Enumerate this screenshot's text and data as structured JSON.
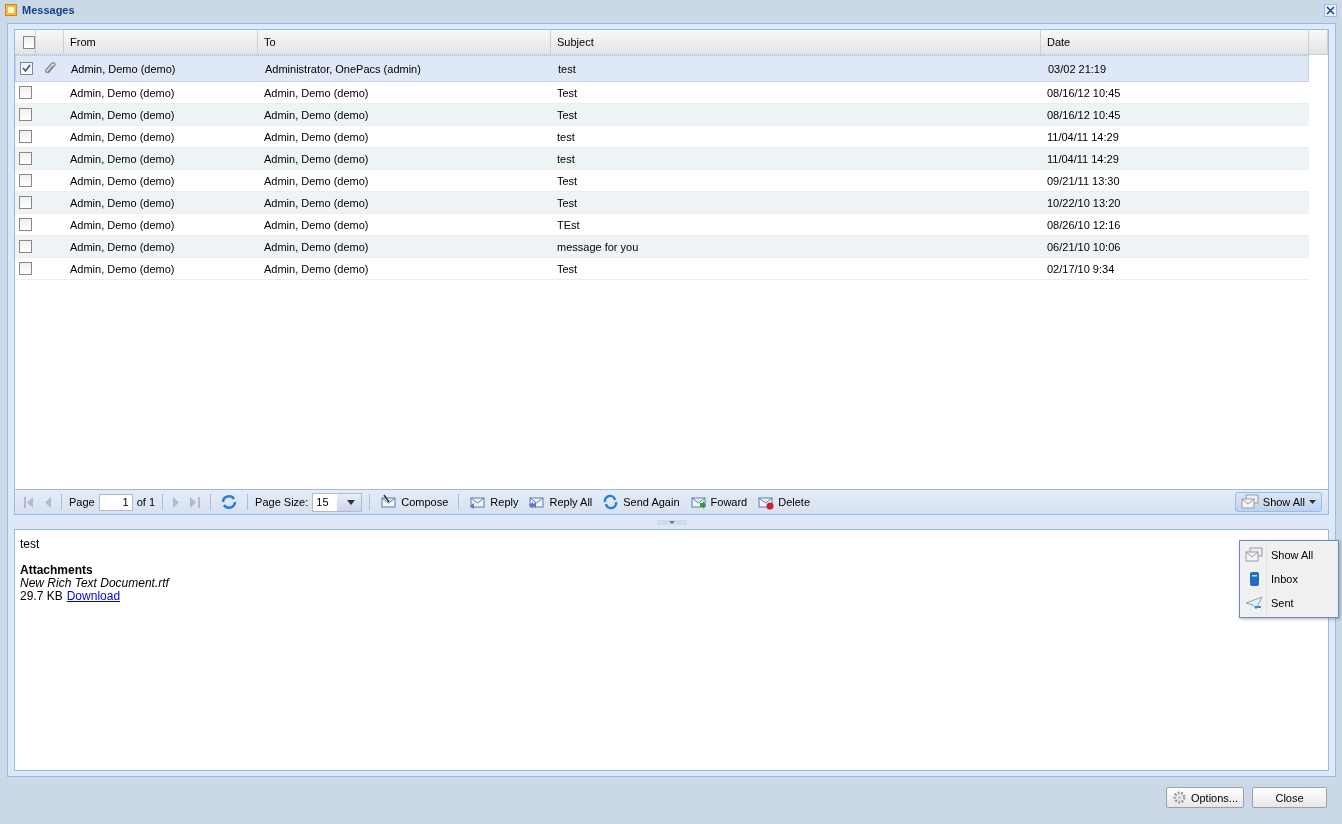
{
  "window": {
    "title": "Messages"
  },
  "table": {
    "columns": [
      "From",
      "To",
      "Subject",
      "Date"
    ],
    "header_checked": false,
    "rows": [
      {
        "checked": true,
        "selected": true,
        "attachment": true,
        "from": "Admin, Demo (demo)",
        "to": "Administrator, OnePacs (admin)",
        "subject": "test",
        "date": "03/02 21:19"
      },
      {
        "checked": false,
        "selected": false,
        "attachment": false,
        "from": "Admin, Demo (demo)",
        "to": "Admin, Demo (demo)",
        "subject": "Test",
        "date": "08/16/12 10:45"
      },
      {
        "checked": false,
        "selected": false,
        "attachment": false,
        "from": "Admin, Demo (demo)",
        "to": "Admin, Demo (demo)",
        "subject": "Test",
        "date": "08/16/12 10:45"
      },
      {
        "checked": false,
        "selected": false,
        "attachment": false,
        "from": "Admin, Demo (demo)",
        "to": "Admin, Demo (demo)",
        "subject": "test",
        "date": "11/04/11 14:29"
      },
      {
        "checked": false,
        "selected": false,
        "attachment": false,
        "from": "Admin, Demo (demo)",
        "to": "Admin, Demo (demo)",
        "subject": "test",
        "date": "11/04/11 14:29"
      },
      {
        "checked": false,
        "selected": false,
        "attachment": false,
        "from": "Admin, Demo (demo)",
        "to": "Admin, Demo (demo)",
        "subject": "Test",
        "date": "09/21/11 13:30"
      },
      {
        "checked": false,
        "selected": false,
        "attachment": false,
        "from": "Admin, Demo (demo)",
        "to": "Admin, Demo (demo)",
        "subject": "Test",
        "date": "10/22/10 13:20"
      },
      {
        "checked": false,
        "selected": false,
        "attachment": false,
        "from": "Admin, Demo (demo)",
        "to": "Admin, Demo (demo)",
        "subject": "TEst",
        "date": "08/26/10 12:16"
      },
      {
        "checked": false,
        "selected": false,
        "attachment": false,
        "from": "Admin, Demo (demo)",
        "to": "Admin, Demo (demo)",
        "subject": "message for you",
        "date": "06/21/10 10:06"
      },
      {
        "checked": false,
        "selected": false,
        "attachment": false,
        "from": "Admin, Demo (demo)",
        "to": "Admin, Demo (demo)",
        "subject": "Test",
        "date": "02/17/10 9:34"
      }
    ]
  },
  "pager": {
    "page_label": "Page",
    "page": "1",
    "of": "of 1",
    "page_size_label": "Page Size:",
    "page_size": "15"
  },
  "actions": [
    {
      "kind": "compose",
      "label": "Compose"
    },
    {
      "kind": "reply",
      "label": "Reply"
    },
    {
      "kind": "reply_all",
      "label": "Reply All"
    },
    {
      "kind": "send_again",
      "label": "Send Again"
    },
    {
      "kind": "forward",
      "label": "Foward"
    },
    {
      "kind": "delete",
      "label": "Delete"
    }
  ],
  "filter": {
    "label": "Show All",
    "menu": [
      {
        "kind": "all",
        "label": "Show All"
      },
      {
        "kind": "inbox",
        "label": "Inbox"
      },
      {
        "kind": "sent",
        "label": "Sent"
      }
    ]
  },
  "preview": {
    "body": "test",
    "attachments_heading": "Attachments",
    "file_name": "New Rich Text Document.rtf",
    "file_size": "29.7 KB",
    "download": "Download"
  },
  "footer": {
    "buttons": [
      {
        "kind": "options",
        "label": "Options..."
      },
      {
        "kind": "close",
        "label": "Close"
      }
    ]
  }
}
